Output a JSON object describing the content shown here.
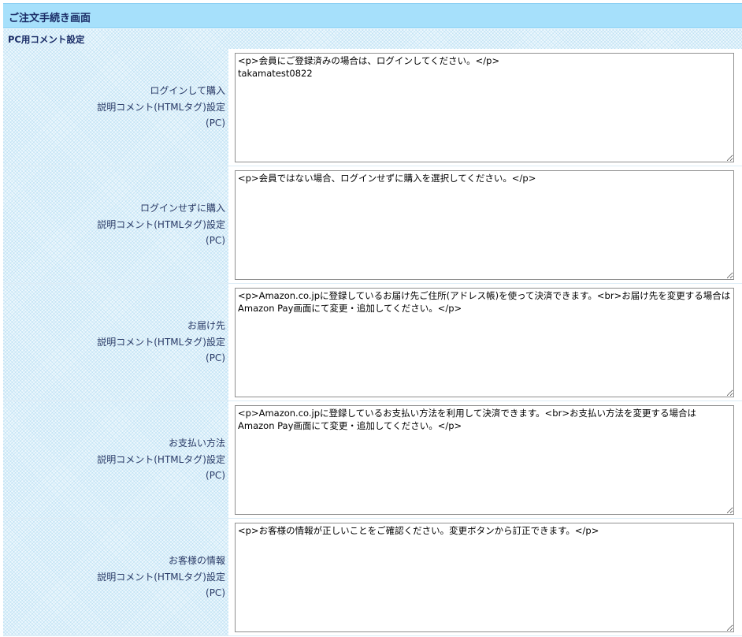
{
  "page_title": "ご注文手続き画面",
  "section_title": "PC用コメント設定",
  "rows": [
    {
      "label_line1": "ログインして購入",
      "label_line2": "説明コメント(HTMLタグ)設定",
      "label_line3": "(PC)",
      "value": "<p>会員にご登録済みの場合は、ログインしてください。</p>\ntakamatest0822"
    },
    {
      "label_line1": "ログインせずに購入",
      "label_line2": "説明コメント(HTMLタグ)設定",
      "label_line3": "(PC)",
      "value": "<p>会員ではない場合、ログインせずに購入を選択してください。</p>"
    },
    {
      "label_line1": "お届け先",
      "label_line2": "説明コメント(HTMLタグ)設定",
      "label_line3": "(PC)",
      "value": "<p>Amazon.co.jpに登録しているお届け先ご住所(アドレス帳)を使って決済できます。<br>お届け先を変更する場合はAmazon Pay画面にて変更・追加してください。</p>"
    },
    {
      "label_line1": "お支払い方法",
      "label_line2": "説明コメント(HTMLタグ)設定",
      "label_line3": "(PC)",
      "value": "<p>Amazon.co.jpに登録しているお支払い方法を利用して決済できます。<br>お支払い方法を変更する場合はAmazon Pay画面にて変更・追加してください。</p>"
    },
    {
      "label_line1": "お客様の情報",
      "label_line2": "説明コメント(HTMLタグ)設定",
      "label_line3": "(PC)",
      "value": "<p>お客様の情報が正しいことをご確認ください。変更ボタンから訂正できます。</p>"
    }
  ]
}
